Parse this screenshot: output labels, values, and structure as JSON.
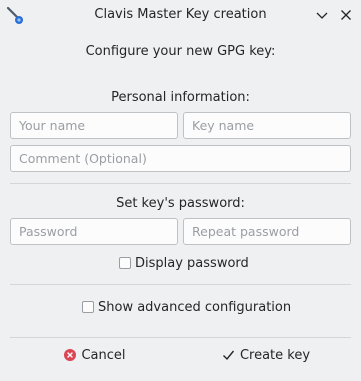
{
  "window": {
    "title": "Clavis Master Key creation",
    "app_icon": "clavis-key-icon",
    "controls": [
      "chevron-down-icon",
      "close-icon"
    ]
  },
  "form": {
    "heading": "Configure your new GPG key:",
    "personal_heading": "Personal information:",
    "your_name_placeholder": "Your name",
    "your_name_value": "",
    "key_name_placeholder": "Key name",
    "key_name_value": "",
    "comment_placeholder": "Comment (Optional)",
    "comment_value": "",
    "password_heading": "Set key's password:",
    "password_placeholder": "Password",
    "repeat_password_placeholder": "Repeat password",
    "display_password_label": "Display password",
    "display_password_checked": false,
    "advanced_label": "Show advanced configuration",
    "advanced_checked": false
  },
  "buttons": {
    "cancel_label": "Cancel",
    "cancel_icon": "cancel-icon",
    "create_label": "Create key",
    "create_icon": "checkmark-icon"
  },
  "colors": {
    "background": "#eff0f1",
    "field_border": "#bfc2c5",
    "icon_blue": "#2a6fd6",
    "cancel_red": "#da4453",
    "text": "#232629"
  }
}
